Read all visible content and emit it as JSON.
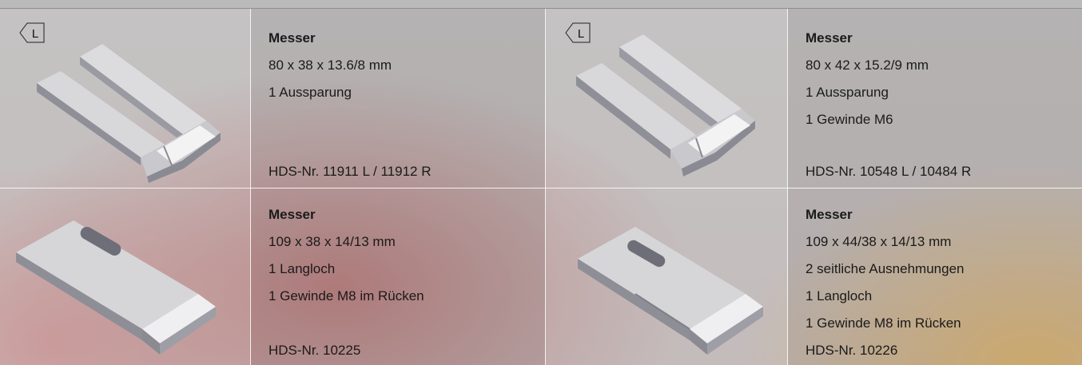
{
  "products": [
    {
      "title": "Messer",
      "specs": [
        "80 x 38 x 13.6/8 mm",
        "1 Aussparung"
      ],
      "hds": "HDS-Nr. 11911 L / 11912 R",
      "badge": "L",
      "image_icon": "knife-blade-slotted-image"
    },
    {
      "title": "Messer",
      "specs": [
        "80 x 42 x 15.2/9 mm",
        "1 Aussparung",
        "1 Gewinde M6"
      ],
      "hds": "HDS-Nr. 10548 L / 10484 R",
      "badge": "L",
      "image_icon": "knife-blade-slotted-image"
    },
    {
      "title": "Messer",
      "specs": [
        "109 x 38 x 14/13 mm",
        "1 Langloch",
        "1 Gewinde M8 im Rücken"
      ],
      "hds": "HDS-Nr. 10225",
      "image_icon": "knife-blade-longhole-image"
    },
    {
      "title": "Messer",
      "specs": [
        "109 x 44/38 x 14/13 mm",
        "2 seitliche Ausnehmungen",
        "1 Langloch",
        "1 Gewinde M8 im Rücken"
      ],
      "hds": "HDS-Nr. 10226",
      "image_icon": "knife-blade-longhole-image"
    }
  ],
  "colors": {
    "text": "#1a1a1a",
    "divider": "#ffffff",
    "accent": "#d4aa60"
  }
}
